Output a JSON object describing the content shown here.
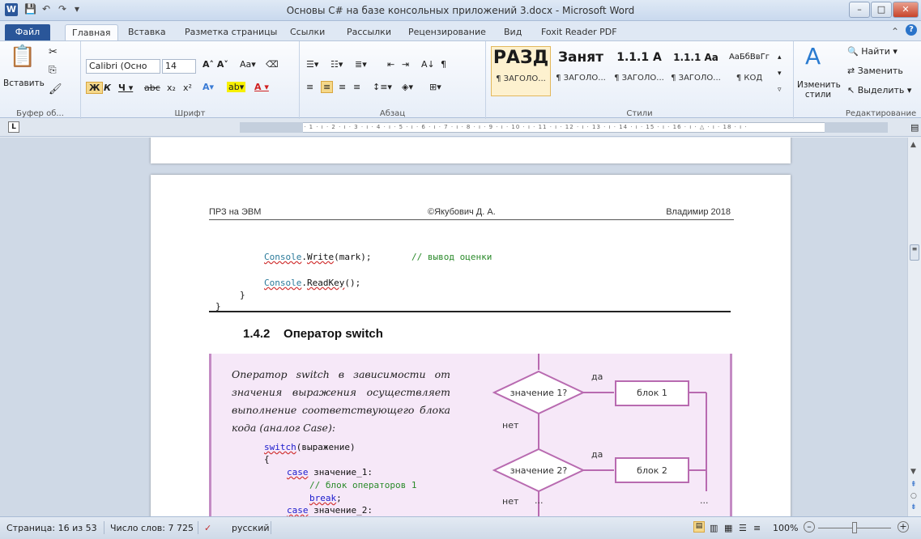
{
  "window": {
    "title": "Основы C# на базе консольных приложений 3.docx  -  Microsoft Word",
    "app_icon": "W"
  },
  "tabs": [
    {
      "label": "Файл"
    },
    {
      "label": "Главная"
    },
    {
      "label": "Вставка"
    },
    {
      "label": "Разметка страницы"
    },
    {
      "label": "Ссылки"
    },
    {
      "label": "Рассылки"
    },
    {
      "label": "Рецензирование"
    },
    {
      "label": "Вид"
    },
    {
      "label": "Foxit Reader PDF"
    }
  ],
  "ribbon": {
    "paste_label": "Вставить",
    "font_name": "Calibri (Осно",
    "font_size": "14",
    "groups": {
      "clipboard": "Буфер об...",
      "font": "Шрифт",
      "paragraph": "Абзац",
      "styles": "Стили",
      "editing": "Редактирование"
    },
    "styles": [
      {
        "preview": "РАЗД",
        "name": "¶ ЗАГОЛО..."
      },
      {
        "preview": "Занят",
        "name": "¶ ЗАГОЛО..."
      },
      {
        "preview": "1.1.1 А",
        "name": "¶ ЗАГОЛО..."
      },
      {
        "preview": "1.1.1 Аа",
        "name": "¶ ЗАГОЛО..."
      },
      {
        "preview": "АаБбВвГг",
        "name": "¶ КОД"
      }
    ],
    "change_styles": "Изменить стили",
    "find": "Найти",
    "replace": "Заменить",
    "select": "Выделить"
  },
  "ruler_text": "2 · ı · 1 · ı · ⨯ · ı · 1 · ı · 2 · ı · 3 · ı · 4 · ı · 5 · ı · 6 · ı · 7 · ı · 8 · ı · 9 · ı · 10 · ı · 11 · ı · 12 · ı · 13 · ı · 14 · ı · 15 · ı · 16 · ı · △ · ı · 18 · ı ·",
  "document": {
    "header_left": "ПРЗ на ЭВМ",
    "header_center": "©Якубович Д. А.",
    "header_right": "Владимир 2018",
    "code1_cls": "Console",
    "code1_method": "Write",
    "code1_rest": "(mark);",
    "code1_comment": "// вывод оценки",
    "code2_cls": "Console",
    "code2_method": "ReadKey",
    "code2_rest": "();",
    "brace1": "}",
    "brace2": "}",
    "heading_number": "1.4.2",
    "heading_text": "Оператор switch",
    "desc": "Оператор switch в зависимости от значения выражения осуществляет выполнение соответствующего блока кода (аналог Case):",
    "switch_kw": "switch",
    "switch_rest": "(выражение)",
    "open_brace": "{",
    "case1_kw": "case",
    "case1_rest": " значение_1:",
    "block1_comment": "// блок операторов 1",
    "break_kw": "break",
    "break_rest": ";",
    "case2_kw": "case",
    "case2_rest": " значение_2:",
    "flow": {
      "cond1": "значение 1?",
      "cond2": "значение 2?",
      "block1": "блок 1",
      "block2": "блок 2",
      "yes": "да",
      "no": "нет",
      "dots": "..."
    }
  },
  "status": {
    "page": "Страница: 16 из 53",
    "words": "Число слов: 7 725",
    "lang": "русский",
    "zoom": "100%"
  }
}
